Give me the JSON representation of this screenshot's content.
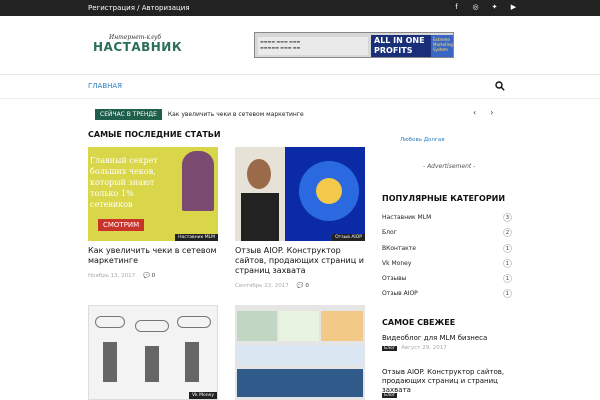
{
  "topbar": {
    "links": "Регистрация / Авторизация",
    "social": [
      "facebook-icon",
      "instagram-icon",
      "twitter-icon",
      "youtube-icon"
    ]
  },
  "logo": {
    "small": "Интернет-клуб",
    "big": "НАСТАВНИК"
  },
  "banner": {
    "line1": "ALL IN ONE",
    "line2": "PROFITS",
    "side": "Extreme Marketing System"
  },
  "nav": {
    "home": "ГЛАВНАЯ"
  },
  "trending": {
    "tag": "СЕЙЧАС В ТРЕНДЕ",
    "title": "Как увеличить чеки в сетевом маркетинге"
  },
  "section": {
    "latest": "САМЫЕ ПОСЛЕДНИЕ СТАТЬИ"
  },
  "articles": [
    {
      "title": "Как увеличить чеки в сетевом маркетинге",
      "category": "Наставник MLM",
      "date": "Ноябрь 13, 2017",
      "comments": "0",
      "thumb_text": "Главный секрет больших чеков, который знают только 1% сетевиков",
      "thumb_button": "СМОТРИМ"
    },
    {
      "title": "Отзыв AIOP. Конструктор сайтов, продающих страниц и страниц захвата",
      "category": "Отзыв AIOP",
      "date": "Сентябрь 22, 2017",
      "comments": "0"
    },
    {
      "category": "Vk Money"
    },
    {
      "category": ""
    }
  ],
  "sidebar": {
    "link": "Любовь Долгая",
    "ad_label": "- Advertisement -",
    "categories_title": "ПОПУЛЯРНЫЕ КАТЕГОРИИ",
    "categories": [
      {
        "label": "Наставник MLM",
        "count": "3"
      },
      {
        "label": "Блог",
        "count": "2"
      },
      {
        "label": "ВКонтакте",
        "count": "1"
      },
      {
        "label": "Vk Money",
        "count": "1"
      },
      {
        "label": "Отзывы",
        "count": "1"
      },
      {
        "label": "Отзыв AIOP",
        "count": "1"
      }
    ],
    "fresh_title": "САМОЕ СВЕЖЕЕ",
    "fresh": [
      {
        "title": "Видеоблог для MLM бизнеса",
        "badge": "Блог",
        "date": "Август 29, 2017"
      },
      {
        "title": "Отзыв AIOP. Конструктор сайтов, продающих страниц и страниц захвата",
        "badge": "Блог",
        "date": ""
      }
    ]
  },
  "colors": {
    "accent": "#1d5f4a",
    "link": "#2b7dbf",
    "topbar": "#222222"
  }
}
